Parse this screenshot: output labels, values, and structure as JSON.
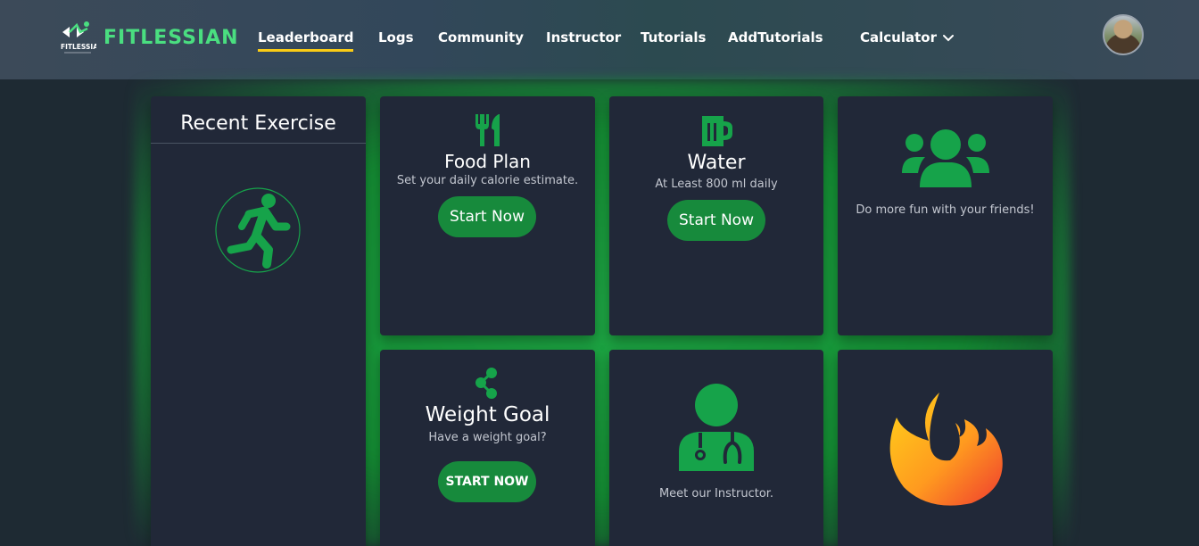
{
  "nav": {
    "brand": "FITLESSIAN",
    "logo_text": "FITLESSIAN",
    "links": [
      "Leaderboard",
      "Logs",
      "Community",
      "Instructor",
      "Tutorials",
      "AddTutorials",
      "Calculator"
    ],
    "active_link": "Leaderboard",
    "dropdown_icon": "chevron-down-icon",
    "avatar_icon": "user-avatar"
  },
  "recent": {
    "title": "Recent Exercise",
    "icon": "running-person-icon"
  },
  "food": {
    "icon": "utensils-icon",
    "title": "Food Plan",
    "subtitle": "Set your daily calorie estimate.",
    "button": "Start Now"
  },
  "water": {
    "icon": "mug-icon",
    "title": "Water",
    "subtitle": "At Least 800 ml daily",
    "button": "Start Now"
  },
  "friends": {
    "icon": "users-icon",
    "subtitle": "Do more fun with your friends!"
  },
  "weight": {
    "icon": "share-nodes-icon",
    "title": "Weight Goal",
    "subtitle": "Have a weight goal?",
    "button": "START NOW"
  },
  "instructor": {
    "icon": "doctor-icon",
    "subtitle": "Meet our Instructor."
  },
  "fire": {
    "icon": "fire-icon"
  },
  "colors": {
    "accent_green": "#178a3c",
    "icon_green": "#16a34a",
    "brand_green": "#4ade80",
    "active_underline": "#facc15",
    "card_bg": "#212838"
  }
}
